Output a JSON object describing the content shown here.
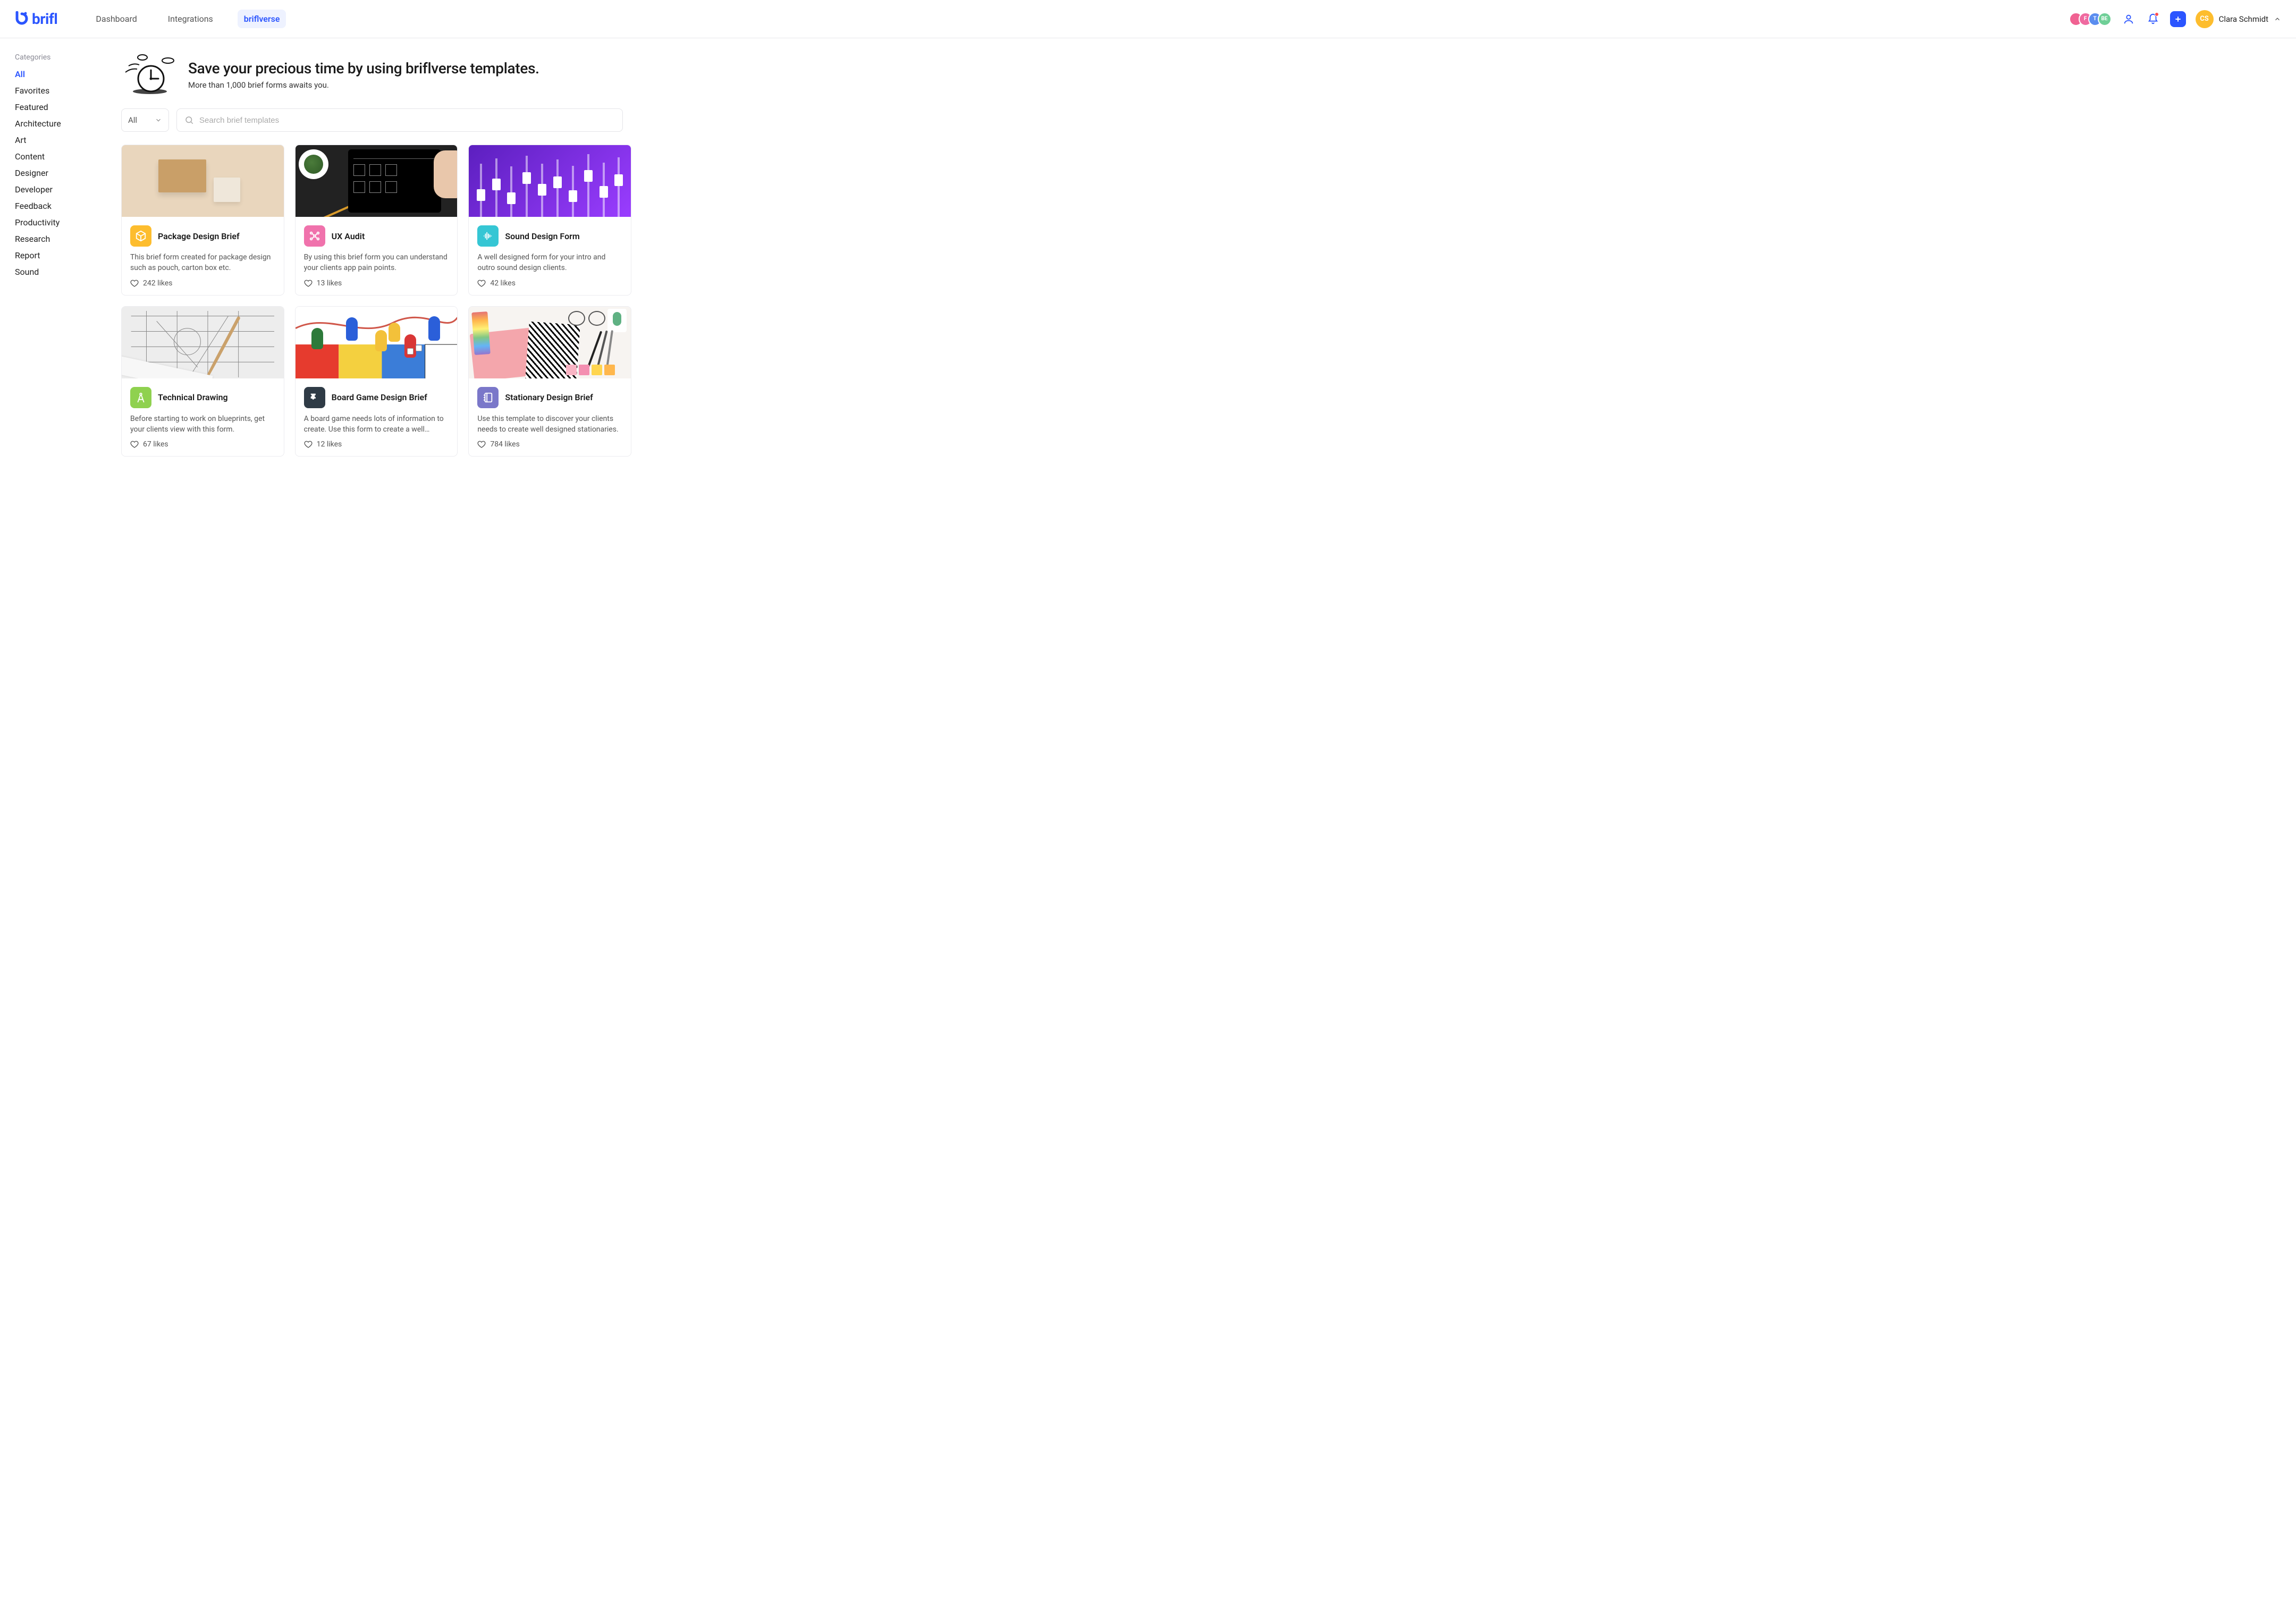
{
  "header": {
    "brand": "brifl",
    "nav": [
      "Dashboard",
      "Integrations",
      "briflverse"
    ],
    "nav_active_index": 2,
    "collab_avatars": [
      {
        "label": "",
        "color": "#f06292"
      },
      {
        "label": "F",
        "color": "#ef6aa0"
      },
      {
        "label": "T",
        "color": "#5b8def"
      },
      {
        "label": "BE",
        "color": "#6fcf97"
      }
    ],
    "user": {
      "initials": "CS",
      "name": "Clara Schmidt"
    }
  },
  "sidebar": {
    "title": "Categories",
    "items": [
      "All",
      "Favorites",
      "Featured",
      "Architecture",
      "Art",
      "Content",
      "Designer",
      "Developer",
      "Feedback",
      "Productivity",
      "Research",
      "Report",
      "Sound"
    ],
    "active_index": 0
  },
  "hero": {
    "title": "Save your precious time by using briflverse templates.",
    "subtitle": "More than 1,000 brief forms awaits you."
  },
  "search": {
    "filter_label": "All",
    "placeholder": "Search brief templates"
  },
  "likes_suffix": "likes",
  "cards": [
    {
      "title": "Package Design Brief",
      "desc": "This brief form created for package design such as pouch, carton box etc.",
      "likes": 242,
      "color": "#fdbd2e",
      "icon": "package",
      "thumb": "package"
    },
    {
      "title": "UX Audit",
      "desc": "By using this brief form you can understand your clients app pain points.",
      "likes": 13,
      "color": "#f072ac",
      "icon": "network",
      "thumb": "ux"
    },
    {
      "title": "Sound Design Form",
      "desc": "A well designed form for your intro and outro sound design clients.",
      "likes": 42,
      "color": "#35c6d4",
      "icon": "waveform",
      "thumb": "sound"
    },
    {
      "title": "Technical Drawing",
      "desc": "Before starting to work on blueprints, get your clients view with this form.",
      "likes": 67,
      "color": "#8fd14f",
      "icon": "compass",
      "thumb": "tech"
    },
    {
      "title": "Board Game Design Brief",
      "desc": "A board game needs lots of information to create. Use this form to create a well design...",
      "likes": 12,
      "color": "#2f3b46",
      "icon": "puzzle",
      "thumb": "board"
    },
    {
      "title": "Stationary Design Brief",
      "desc": "Use this template to discover your clients needs to create well designed stationaries.",
      "likes": 784,
      "color": "#7a77c9",
      "icon": "notebook",
      "thumb": "stat"
    }
  ]
}
